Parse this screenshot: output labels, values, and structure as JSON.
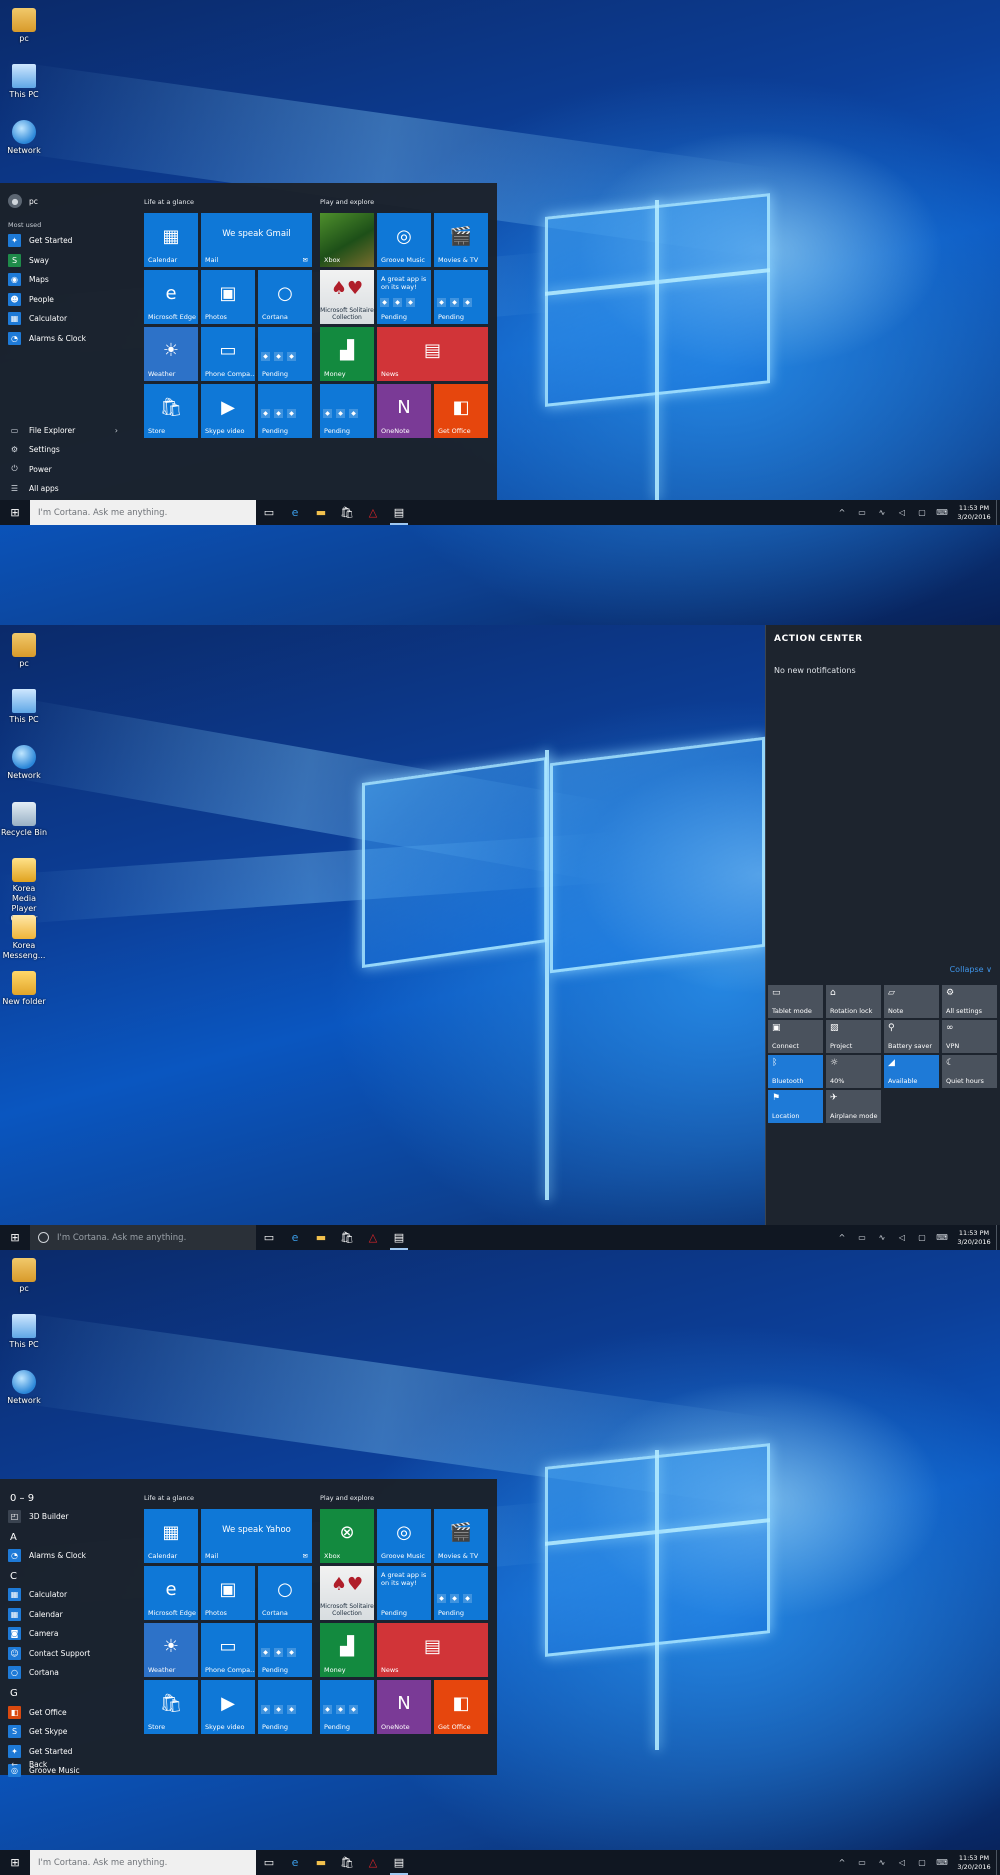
{
  "desktop_icons": {
    "pc": "pc",
    "this_pc": "This PC",
    "network": "Network",
    "recycle_bin": "Recycle Bin",
    "korea_media": "Korea Media Player Center",
    "korea_messenger": "Korea Messeng...",
    "new_folder": "New folder"
  },
  "start_menu": {
    "user": "pc",
    "most_used_header": "Most used",
    "most_used": [
      "Get Started",
      "Sway",
      "Maps",
      "People",
      "Calculator",
      "Alarms & Clock"
    ],
    "places": [
      "File Explorer",
      "Settings",
      "Power",
      "All apps"
    ],
    "group_life": "Life at a glance",
    "group_play": "Play and explore",
    "tiles": {
      "calendar": "Calendar",
      "mail": "Mail",
      "mail_gmail": "We speak Gmail",
      "mail_yahoo": "We speak Yahoo",
      "edge": "Microsoft Edge",
      "photos": "Photos",
      "cortana": "Cortana",
      "weather": "Weather",
      "phone": "Phone Compa...",
      "pending": "Pending",
      "store": "Store",
      "skype": "Skype video",
      "xbox": "Xbox",
      "groove": "Groove Music",
      "movies": "Movies & TV",
      "solitaire": "Microsoft Solitaire Collection",
      "great_app": "A great app is on its way!",
      "money": "Money",
      "news": "News",
      "onenote": "OneNote",
      "office": "Get Office"
    }
  },
  "all_apps": {
    "letters": [
      "0 – 9",
      "A",
      "C",
      "G"
    ],
    "items": {
      "builder": "3D Builder",
      "alarms": "Alarms & Clock",
      "calculator": "Calculator",
      "calendar": "Calendar",
      "camera": "Camera",
      "contact": "Contact Support",
      "cortana": "Cortana",
      "office": "Get Office",
      "skype": "Get Skype",
      "started": "Get Started",
      "groove": "Groove Music"
    },
    "back": "Back"
  },
  "taskbar": {
    "search_placeholder": "I'm Cortana. Ask me anything.",
    "time": "11:53 PM",
    "date": "3/20/2016"
  },
  "action_center": {
    "title": "ACTION CENTER",
    "empty": "No new notifications",
    "collapse": "Collapse ∨",
    "quick_actions": [
      {
        "label": "Tablet mode",
        "on": false
      },
      {
        "label": "Rotation lock",
        "on": false
      },
      {
        "label": "Note",
        "on": false
      },
      {
        "label": "All settings",
        "on": false
      },
      {
        "label": "Connect",
        "on": false
      },
      {
        "label": "Project",
        "on": false
      },
      {
        "label": "Battery saver",
        "on": false
      },
      {
        "label": "VPN",
        "on": false
      },
      {
        "label": "Bluetooth",
        "on": true
      },
      {
        "label": "40%",
        "on": false
      },
      {
        "label": "Available",
        "on": true
      },
      {
        "label": "Quiet hours",
        "on": false
      },
      {
        "label": "Location",
        "on": true
      },
      {
        "label": "Airplane mode",
        "on": false
      }
    ]
  },
  "colors": {
    "accent": "#0f78d7",
    "start_bg": "#1b212a",
    "taskbar_bg": "#101722",
    "action_center_bg": "#1d242e"
  }
}
